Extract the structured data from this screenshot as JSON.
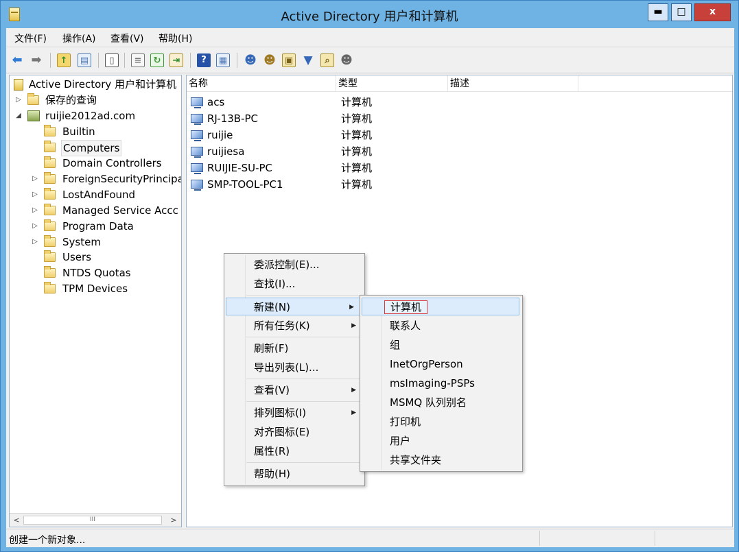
{
  "window": {
    "title": "Active Directory 用户和计算机",
    "controls": {
      "minimize": "▬",
      "maximize": "□",
      "close": "x"
    }
  },
  "menu": {
    "items": [
      "文件(F)",
      "操作(A)",
      "查看(V)",
      "帮助(H)"
    ]
  },
  "toolbar": {
    "icons": [
      "back-arrow-icon",
      "forward-arrow-icon",
      "up-folder-icon",
      "show-tree-icon",
      "clipboard-icon",
      "properties-icon",
      "refresh-icon",
      "export-list-icon",
      "help-icon",
      "console-icon",
      "new-user-icon",
      "new-group-icon",
      "new-ou-icon",
      "filter-icon",
      "find-icon",
      "delegate-icon"
    ]
  },
  "tree": {
    "root": "Active Directory 用户和计算机",
    "saved_queries": "保存的查询",
    "domain": "ruijie2012ad.com",
    "children": [
      "Builtin",
      "Computers",
      "Domain Controllers",
      "ForeignSecurityPrincipa",
      "LostAndFound",
      "Managed Service Accc",
      "Program Data",
      "System",
      "Users",
      "NTDS Quotas",
      "TPM Devices"
    ],
    "selected": "Computers",
    "scroll_label": "III",
    "scroll_left": "<",
    "scroll_right": ">"
  },
  "list": {
    "columns": [
      "名称",
      "类型",
      "描述"
    ],
    "rows": [
      {
        "name": "acs",
        "type": "计算机"
      },
      {
        "name": "RJ-13B-PC",
        "type": "计算机"
      },
      {
        "name": "ruijie",
        "type": "计算机"
      },
      {
        "name": "ruijiesa",
        "type": "计算机"
      },
      {
        "name": "RUIJIE-SU-PC",
        "type": "计算机"
      },
      {
        "name": "SMP-TOOL-PC1",
        "type": "计算机"
      }
    ]
  },
  "context_menu": {
    "items": [
      "委派控制(E)...",
      "查找(I)...",
      "新建(N)",
      "所有任务(K)",
      "刷新(F)",
      "导出列表(L)...",
      "查看(V)",
      "排列图标(I)",
      "对齐图标(E)",
      "属性(R)",
      "帮助(H)"
    ],
    "highlighted": "新建(N)",
    "arrow": "▶"
  },
  "submenu": {
    "items": [
      "计算机",
      "联系人",
      "组",
      "InetOrgPerson",
      "msImaging-PSPs",
      "MSMQ 队列别名",
      "打印机",
      "用户",
      "共享文件夹"
    ],
    "highlighted": "计算机"
  },
  "status": {
    "text": "创建一个新对象..."
  }
}
